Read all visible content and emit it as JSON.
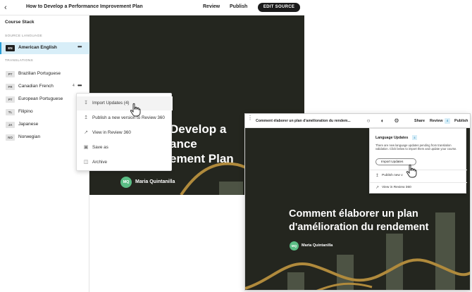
{
  "editor": {
    "course_title": "How to Develop a Performance Improvement Plan",
    "review_label": "Review",
    "publish_label": "Publish",
    "edit_source_label": "EDIT SOURCE",
    "sidebar": {
      "heading": "Course Stack",
      "source_section": "SOURCE LANGUAGE",
      "source": {
        "code": "EN",
        "name": "American English"
      },
      "translations_section": "TRANSLATIONS",
      "translations": [
        {
          "code": "PT",
          "name": "Brazilian Portuguese"
        },
        {
          "code": "FR",
          "name": "Canadian French",
          "count": "4"
        },
        {
          "code": "PT",
          "name": "European Portuguese"
        },
        {
          "code": "TL",
          "name": "Filipino"
        },
        {
          "code": "JA",
          "name": "Japanese"
        },
        {
          "code": "NO",
          "name": "Norwegian"
        }
      ]
    },
    "context_menu": [
      {
        "label": "Import Updates (4)",
        "icon": "download-icon"
      },
      {
        "label": "Publish a new version to Review 360",
        "icon": "upload-icon"
      },
      {
        "label": "View in Review 360",
        "icon": "external-link-icon"
      },
      {
        "label": "Save as",
        "icon": "save-icon"
      },
      {
        "label": "Archive",
        "icon": "archive-icon"
      }
    ],
    "canvas": {
      "title_lines": [
        "Develop a",
        "ance",
        "ement Plan"
      ],
      "avatar": "MQ",
      "author": "Maria Quintanilla"
    }
  },
  "review": {
    "title": "Comment élaborer un plan d'amélioration du rendem...",
    "share_label": "Share",
    "review_label": "Review",
    "review_count": "4",
    "publish_label": "Publish",
    "panel": {
      "heading": "Language Updates",
      "count": "4",
      "description": "There are new language updates pending from translation validation. Click below to import them and update your course.",
      "import_label": "Import Updates",
      "publish_label": "Publish new v",
      "view_label": "View in Review 360"
    },
    "canvas": {
      "heading_lines": [
        "Comment élaborer un plan",
        "d'amélioration du rendement"
      ],
      "avatar": "MQ",
      "author": "Maria Quintanilla"
    }
  },
  "colors": {
    "accent": "#2a9fd8",
    "canvas_bg": "#24261f",
    "wave": "#b08a3c",
    "bars": "#4d5344",
    "avatar": "#5bbd85"
  }
}
